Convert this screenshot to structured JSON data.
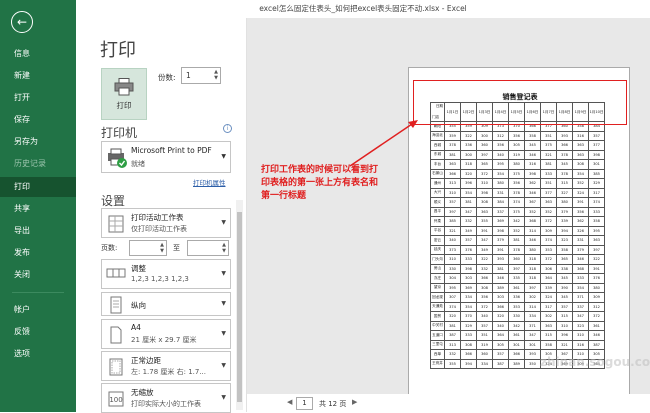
{
  "window": {
    "title": "excel怎么固定住表头_如何把excel表头固定不动.xlsx  -  Excel"
  },
  "sidebar": {
    "back_label": "←",
    "items": [
      {
        "label": "信息"
      },
      {
        "label": "新建"
      },
      {
        "label": "打开"
      },
      {
        "label": "保存"
      },
      {
        "label": "另存为"
      },
      {
        "label": "历史记录"
      },
      {
        "label": "打印"
      },
      {
        "label": "共享"
      },
      {
        "label": "导出"
      },
      {
        "label": "发布"
      },
      {
        "label": "关闭"
      },
      {
        "label": "帐户"
      },
      {
        "label": "反馈"
      },
      {
        "label": "选项"
      }
    ]
  },
  "print": {
    "heading": "打印",
    "button_label": "打印",
    "copies_label": "份数:",
    "copies_value": "1"
  },
  "printer": {
    "heading": "打印机",
    "name": "Microsoft Print to PDF",
    "status": "就绪",
    "properties_link": "打印机属性",
    "info_glyph": "i"
  },
  "settings": {
    "heading": "设置",
    "range": {
      "title": "打印活动工作表",
      "subtitle": "仅打印活动工作表"
    },
    "pages_label": "页数:",
    "to_label": "至",
    "collate": {
      "title": "调整",
      "subtitle": "1,2,3    1,2,3    1,2,3"
    },
    "orientation": {
      "title": "纵向"
    },
    "paper": {
      "title": "A4",
      "subtitle": "21 厘米 x 29.7 厘米"
    },
    "margins": {
      "title": "正常边距",
      "subtitle": "左: 1.78 厘米    右: 1.7..."
    },
    "scaling": {
      "title": "无缩放",
      "subtitle": "打印实际大小的工作表"
    }
  },
  "preview": {
    "sheet_title": "销售登记表",
    "corner_top": "日期",
    "corner_bottom": "门店",
    "months": [
      "1月1日",
      "1月2日",
      "1月3日",
      "1月4日",
      "1月5日",
      "1月6日",
      "1月7日",
      "1月8日",
      "1月9日",
      "1月10日"
    ],
    "rows": [
      {
        "store": "朝阳",
        "values": [
          "355",
          "359",
          "309",
          "373",
          "370",
          "366",
          "377",
          "360",
          "358",
          "384"
        ]
      },
      {
        "store": "海淀北",
        "values": [
          "359",
          "322",
          "300",
          "312",
          "356",
          "358",
          "351",
          "393",
          "316",
          "357"
        ]
      },
      {
        "store": "西城",
        "values": [
          "378",
          "336",
          "360",
          "356",
          "305",
          "345",
          "375",
          "366",
          "363",
          "377"
        ]
      },
      {
        "store": "东城",
        "values": [
          "381",
          "300",
          "397",
          "340",
          "319",
          "346",
          "321",
          "378",
          "363",
          "398"
        ]
      },
      {
        "store": "丰台",
        "values": [
          "363",
          "318",
          "365",
          "395",
          "380",
          "316",
          "381",
          "345",
          "308",
          "301"
        ]
      },
      {
        "store": "石景山",
        "values": [
          "366",
          "320",
          "372",
          "354",
          "375",
          "398",
          "333",
          "378",
          "354",
          "385"
        ]
      },
      {
        "store": "通州",
        "values": [
          "313",
          "396",
          "310",
          "380",
          "356",
          "362",
          "351",
          "315",
          "352",
          "329"
        ]
      },
      {
        "store": "大兴",
        "values": [
          "310",
          "354",
          "398",
          "331",
          "378",
          "346",
          "377",
          "327",
          "324",
          "317"
        ]
      },
      {
        "store": "顺义",
        "values": [
          "357",
          "381",
          "308",
          "384",
          "374",
          "367",
          "363",
          "380",
          "391",
          "374"
        ]
      },
      {
        "store": "昌平",
        "values": [
          "397",
          "347",
          "363",
          "337",
          "375",
          "352",
          "352",
          "379",
          "356",
          "333"
        ]
      },
      {
        "store": "怀柔",
        "values": [
          "385",
          "332",
          "355",
          "369",
          "342",
          "368",
          "372",
          "339",
          "362",
          "358"
        ]
      },
      {
        "store": "平谷",
        "values": [
          "321",
          "349",
          "391",
          "398",
          "352",
          "314",
          "309",
          "394",
          "326",
          "395"
        ]
      },
      {
        "store": "密云",
        "values": [
          "340",
          "357",
          "347",
          "379",
          "381",
          "346",
          "374",
          "323",
          "331",
          "363"
        ]
      },
      {
        "store": "延庆",
        "values": [
          "373",
          "376",
          "349",
          "391",
          "378",
          "380",
          "353",
          "358",
          "379",
          "397"
        ]
      },
      {
        "store": "门头沟",
        "values": [
          "310",
          "333",
          "322",
          "393",
          "360",
          "318",
          "372",
          "365",
          "346",
          "322"
        ]
      },
      {
        "store": "房山",
        "values": [
          "330",
          "398",
          "332",
          "381",
          "397",
          "318",
          "306",
          "338",
          "368",
          "391"
        ]
      },
      {
        "store": "亦庄",
        "values": [
          "304",
          "303",
          "366",
          "346",
          "335",
          "318",
          "364",
          "345",
          "333",
          "376"
        ]
      },
      {
        "store": "望京",
        "values": [
          "395",
          "369",
          "308",
          "389",
          "361",
          "397",
          "339",
          "390",
          "354",
          "380"
        ]
      },
      {
        "store": "回龙观",
        "values": [
          "307",
          "334",
          "356",
          "303",
          "336",
          "302",
          "324",
          "345",
          "371",
          "309"
        ]
      },
      {
        "store": "天通苑",
        "values": [
          "374",
          "354",
          "372",
          "366",
          "353",
          "314",
          "317",
          "357",
          "337",
          "312"
        ]
      },
      {
        "store": "国贸",
        "values": [
          "320",
          "370",
          "340",
          "320",
          "330",
          "334",
          "302",
          "315",
          "347",
          "372"
        ]
      },
      {
        "store": "中关村",
        "values": [
          "381",
          "329",
          "357",
          "340",
          "342",
          "371",
          "363",
          "310",
          "323",
          "361"
        ]
      },
      {
        "store": "五道口",
        "values": [
          "387",
          "333",
          "351",
          "364",
          "361",
          "347",
          "315",
          "396",
          "310",
          "346"
        ]
      },
      {
        "store": "三里屯",
        "values": [
          "313",
          "308",
          "319",
          "305",
          "301",
          "301",
          "358",
          "321",
          "316",
          "387"
        ]
      },
      {
        "store": "西单",
        "values": [
          "332",
          "366",
          "360",
          "357",
          "366",
          "393",
          "305",
          "367",
          "310",
          "305"
        ]
      },
      {
        "store": "王府井",
        "values": [
          "355",
          "394",
          "334",
          "387",
          "389",
          "350",
          "324",
          "369",
          "309",
          "364"
        ]
      }
    ],
    "annotation": "打印工作表的时候可以看到打印表格的第一张上方有表名和第一行标题",
    "watermark": "zhinan.sogou.com",
    "current_page": "1",
    "total_pages": "共 12 页",
    "prev_arrow": "◀",
    "next_arrow": "▶"
  },
  "colors": {
    "accent": "#217346",
    "annotation": "#e02020"
  }
}
